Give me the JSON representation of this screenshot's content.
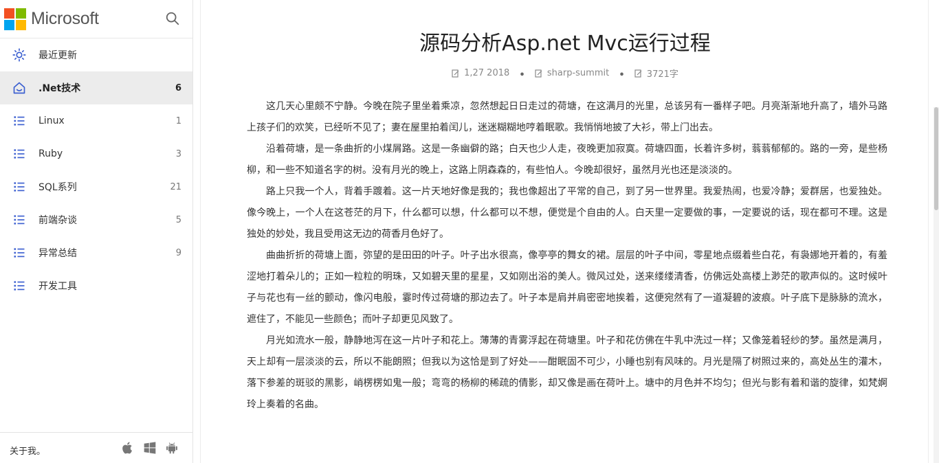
{
  "brand": {
    "name": "Microsoft",
    "logo_colors": [
      "#f25022",
      "#7fba00",
      "#00a4ef",
      "#ffb900"
    ]
  },
  "search": {
    "icon": "search-icon"
  },
  "sidebar": {
    "items": [
      {
        "label": "最近更新",
        "count": "",
        "icon": "sun-icon",
        "active": false
      },
      {
        "label": ".Net技术",
        "count": "6",
        "icon": "home-icon",
        "active": true
      },
      {
        "label": "Linux",
        "count": "1",
        "icon": "list-icon",
        "active": false
      },
      {
        "label": "Ruby",
        "count": "3",
        "icon": "list-icon",
        "active": false
      },
      {
        "label": "SQL系列",
        "count": "21",
        "icon": "list-icon",
        "active": false
      },
      {
        "label": "前端杂谈",
        "count": "5",
        "icon": "list-icon",
        "active": false
      },
      {
        "label": "异常总结",
        "count": "9",
        "icon": "list-icon",
        "active": false
      },
      {
        "label": "开发工具",
        "count": "",
        "icon": "list-icon",
        "active": false
      }
    ],
    "accent_color": "#3b5fd0"
  },
  "footer": {
    "about": "关于我。",
    "icons": [
      "apple-icon",
      "windows-icon",
      "android-icon"
    ]
  },
  "article": {
    "title": "源码分析Asp.net Mvc运行过程",
    "meta": {
      "date": "1,27 2018",
      "author": "sharp-summit",
      "words": "3721字"
    },
    "paragraphs": [
      "这几天心里颇不宁静。今晚在院子里坐着乘凉，忽然想起日日走过的荷塘，在这满月的光里，总该另有一番样子吧。月亮渐渐地升高了，墙外马路上孩子们的欢笑，已经听不见了；妻在屋里拍着闰儿，迷迷糊糊地哼着眠歌。我悄悄地披了大衫，带上门出去。",
      "沿着荷塘，是一条曲折的小煤屑路。这是一条幽僻的路；白天也少人走，夜晚更加寂寞。荷塘四面，长着许多树，蓊蓊郁郁的。路的一旁，是些杨柳，和一些不知道名字的树。没有月光的晚上，这路上阴森森的，有些怕人。今晚却很好，虽然月光也还是淡淡的。",
      "路上只我一个人，背着手踱着。这一片天地好像是我的；我也像超出了平常的自己，到了另一世界里。我爱热闹，也爱冷静；爱群居，也爱独处。像今晚上，一个人在这苍茫的月下，什么都可以想，什么都可以不想，便觉是个自由的人。白天里一定要做的事，一定要说的话，现在都可不理。这是独处的妙处，我且受用这无边的荷香月色好了。",
      "曲曲折折的荷塘上面，弥望的是田田的叶子。叶子出水很高，像亭亭的舞女的裙。层层的叶子中间，零星地点缀着些白花，有袅娜地开着的，有羞涩地打着朵儿的；正如一粒粒的明珠，又如碧天里的星星，又如刚出浴的美人。微风过处，送来缕缕清香，仿佛远处高楼上渺茫的歌声似的。这时候叶子与花也有一丝的颤动，像闪电般，霎时传过荷塘的那边去了。叶子本是肩并肩密密地挨着，这便宛然有了一道凝碧的波痕。叶子底下是脉脉的流水，遮住了，不能见一些颜色；而叶子却更见风致了。",
      "月光如流水一般，静静地泻在这一片叶子和花上。薄薄的青雾浮起在荷塘里。叶子和花仿佛在牛乳中洗过一样；又像笼着轻纱的梦。虽然是满月，天上却有一层淡淡的云，所以不能朗照；但我以为这恰是到了好处——酣眠固不可少，小睡也别有风味的。月光是隔了树照过来的，高处丛生的灌木，落下参差的斑驳的黑影，峭楞楞如鬼一般；弯弯的杨柳的稀疏的倩影，却又像是画在荷叶上。塘中的月色并不均匀；但光与影有着和谐的旋律，如梵婀玲上奏着的名曲。"
    ]
  }
}
